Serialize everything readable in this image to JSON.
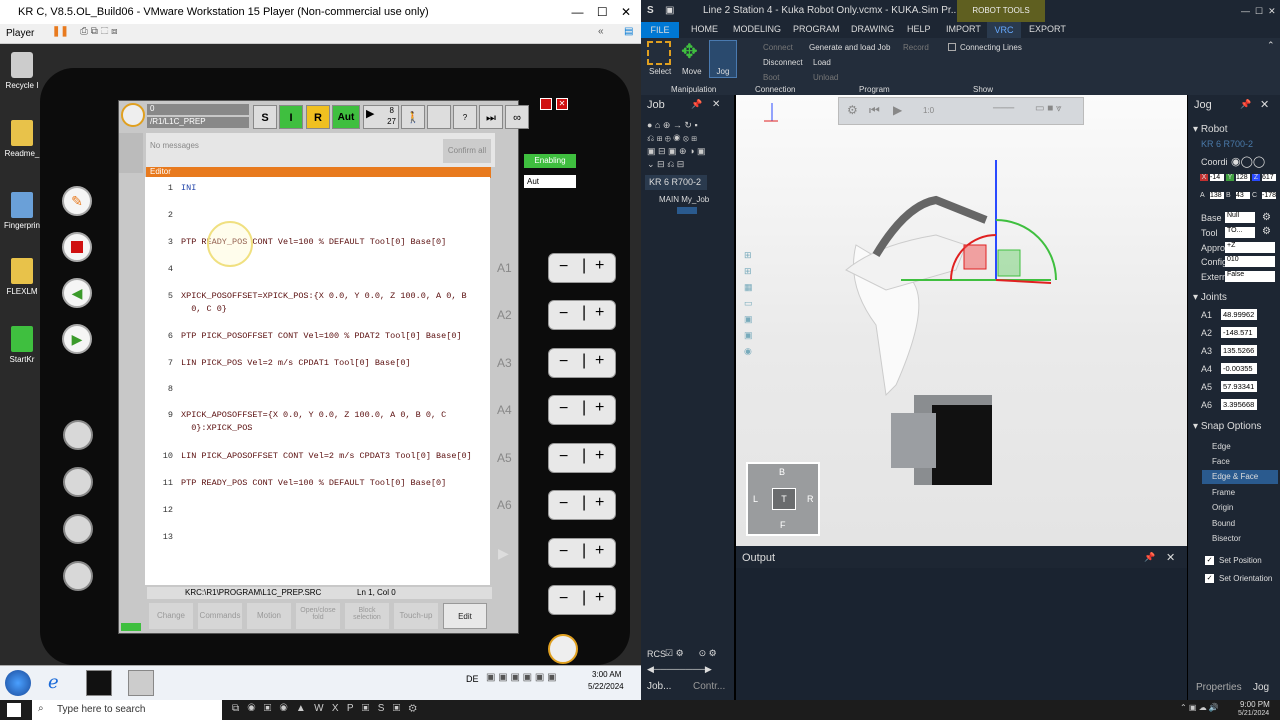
{
  "vm": {
    "title": "KR C, V8.5.OL_Build06 - VMware Workstation 15 Player (Non-commercial use only)",
    "player": "Player",
    "desktop_icons": [
      "Recycle I",
      "Readme_",
      "Fingerprin",
      "FLEXLM",
      "StartKr"
    ]
  },
  "smartpad": {
    "status_top": "0",
    "program_path": "/R1/L1C_PREP",
    "btn_s": "S",
    "btn_i": "I",
    "btn_r": "R",
    "btn_aut": "Aut",
    "override_top": "8",
    "override_bottom": "27",
    "messages_placeholder": "No messages",
    "confirm_all": "Confirm all",
    "enabling": "Enabling",
    "mode_select": "Aut",
    "editor_title": "Editor",
    "lines": [
      {
        "n": "1",
        "t": "INI"
      },
      {
        "n": "2",
        "t": ""
      },
      {
        "n": "3",
        "t": "PTP READY_POS CONT Vel=100 % DEFAULT Tool[0] Base[0]"
      },
      {
        "n": "4",
        "t": ""
      },
      {
        "n": "5",
        "t": "XPICK_POSOFFSET=XPICK_POS:{X 0.0, Y 0.0, Z 100.0, A 0, B"
      },
      {
        "n": "",
        "t": "  0, C 0}"
      },
      {
        "n": "6",
        "t": "PTP PICK_POSOFFSET CONT Vel=100 % PDAT2 Tool[0] Base[0]"
      },
      {
        "n": "7",
        "t": "LIN PICK_POS Vel=2 m/s CPDAT1 Tool[0] Base[0]"
      },
      {
        "n": "8",
        "t": ""
      },
      {
        "n": "9",
        "t": "XPICK_APOSOFFSET={X 0.0, Y 0.0, Z 100.0, A 0, B 0, C"
      },
      {
        "n": "",
        "t": "  0}:XPICK_POS"
      },
      {
        "n": "10",
        "t": "LIN PICK_APOSOFFSET CONT Vel=2 m/s CPDAT3 Tool[0] Base[0]"
      },
      {
        "n": "11",
        "t": "PTP READY_POS CONT Vel=100 % DEFAULT Tool[0] Base[0]"
      },
      {
        "n": "12",
        "t": ""
      },
      {
        "n": "13",
        "t": ""
      }
    ],
    "status_path": "KRC:\\R1\\PROGRAM\\L1C_PREP.SRC",
    "status_pos": "Ln 1, Col 0",
    "bottom_buttons": [
      "Change",
      "Commands",
      "Motion",
      "Open/close fold",
      "Block selection",
      "Touch-up",
      "Edit"
    ],
    "axes": [
      "A1",
      "A2",
      "A3",
      "A4",
      "A5",
      "A6"
    ]
  },
  "taskbar": {
    "lang": "DE",
    "time": "3:00 AM",
    "date": "5/22/2024",
    "search_placeholder": "Type here to search",
    "host_time": "9:00 PM",
    "host_date": "5/21/2024"
  },
  "kuka": {
    "title": "Line 2 Station 4 - Kuka Robot Only.vcmx - KUKA.Sim Pr...",
    "context_tab": "ROBOT TOOLS",
    "tabs": [
      "FILE",
      "HOME",
      "MODELING",
      "PROGRAM",
      "DRAWING",
      "HELP",
      "IMPORT",
      "VRC",
      "EXPORT"
    ],
    "manipulation": [
      "Select",
      "Move",
      "Jog"
    ],
    "manipulation_label": "Manipulation",
    "connection_items": [
      "Connect",
      "Disconnect",
      "Boot"
    ],
    "connection_label": "Connection",
    "program_items": [
      "Generate and load Job",
      "Record",
      "Load",
      "Unload"
    ],
    "program_label": "Program",
    "show_item": "Connecting Lines",
    "show_label": "Show",
    "job_panel_title": "Job",
    "job_robot": "KR 6 R700-2",
    "job_tree_item": "MAIN My_Job",
    "job_footer": [
      "Job...",
      "Contr..."
    ],
    "rcs": "RCS",
    "viewport_counter": "1:0",
    "nav_cube": {
      "top": "B",
      "left": "L",
      "center": "T",
      "right": "R",
      "bottom": "F"
    },
    "output_title": "Output",
    "jog_title": "Jog",
    "robot_section": "Robot",
    "robot_name": "KR 6 R700-2",
    "coord_label": "Coordi",
    "xyz": [
      "X",
      "-14",
      "Y",
      "128",
      "Z",
      "617"
    ],
    "abc": [
      "A",
      "138",
      "B",
      "43",
      "C",
      "-178"
    ],
    "base_label": "Base",
    "base_value": "Null",
    "tool_label": "Tool",
    "tool_value": "TO...",
    "appro_label": "Appro",
    "appro_value": "+Z",
    "config_label": "Config",
    "config_value": "010",
    "extern_label": "Extern",
    "extern_value": "False",
    "joints_section": "Joints",
    "joints": [
      {
        "name": "A1",
        "value": "48.99962"
      },
      {
        "name": "A2",
        "value": "-148.571"
      },
      {
        "name": "A3",
        "value": "135.5266"
      },
      {
        "name": "A4",
        "value": "-0.00355"
      },
      {
        "name": "A5",
        "value": "57.93341"
      },
      {
        "name": "A6",
        "value": "3.395668"
      }
    ],
    "snap_section": "Snap Options",
    "snap": [
      "Edge",
      "Face",
      "Edge & Face",
      "Frame",
      "Origin",
      "Bound",
      "Bisector"
    ],
    "set_position": "Set Position",
    "set_orientation": "Set Orientation",
    "footer_tabs": [
      "Properties",
      "Jog"
    ]
  },
  "colors": {
    "accent": "#0078d4",
    "green": "#3fbf3f",
    "orange": "#e87a1e",
    "robot_tools": "#6b6b1f"
  }
}
